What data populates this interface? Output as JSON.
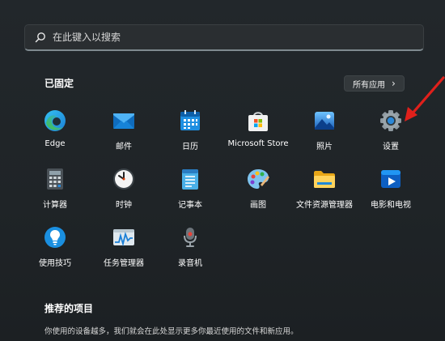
{
  "search": {
    "placeholder": "在此键入以搜索"
  },
  "pinned": {
    "title": "已固定",
    "all_apps_label": "所有应用",
    "apps": [
      {
        "label": "Edge",
        "icon": "edge-icon"
      },
      {
        "label": "邮件",
        "icon": "mail-icon"
      },
      {
        "label": "日历",
        "icon": "calendar-icon"
      },
      {
        "label": "Microsoft Store",
        "icon": "store-icon"
      },
      {
        "label": "照片",
        "icon": "photos-icon"
      },
      {
        "label": "设置",
        "icon": "gear-icon"
      },
      {
        "label": "计算器",
        "icon": "calculator-icon"
      },
      {
        "label": "时钟",
        "icon": "clock-icon"
      },
      {
        "label": "记事本",
        "icon": "notepad-icon"
      },
      {
        "label": "画图",
        "icon": "paint-icon"
      },
      {
        "label": "文件资源管理器",
        "icon": "folder-icon"
      },
      {
        "label": "电影和电视",
        "icon": "movies-tv-icon"
      },
      {
        "label": "使用技巧",
        "icon": "tips-icon"
      },
      {
        "label": "任务管理器",
        "icon": "task-manager-icon"
      },
      {
        "label": "录音机",
        "icon": "voice-recorder-icon"
      }
    ]
  },
  "recommended": {
    "title": "推荐的项目",
    "description": "你使用的设备越多，我们就会在此处显示更多你最近使用的文件和新应用。"
  },
  "annotation": {
    "arrow_color": "#e0201b"
  }
}
